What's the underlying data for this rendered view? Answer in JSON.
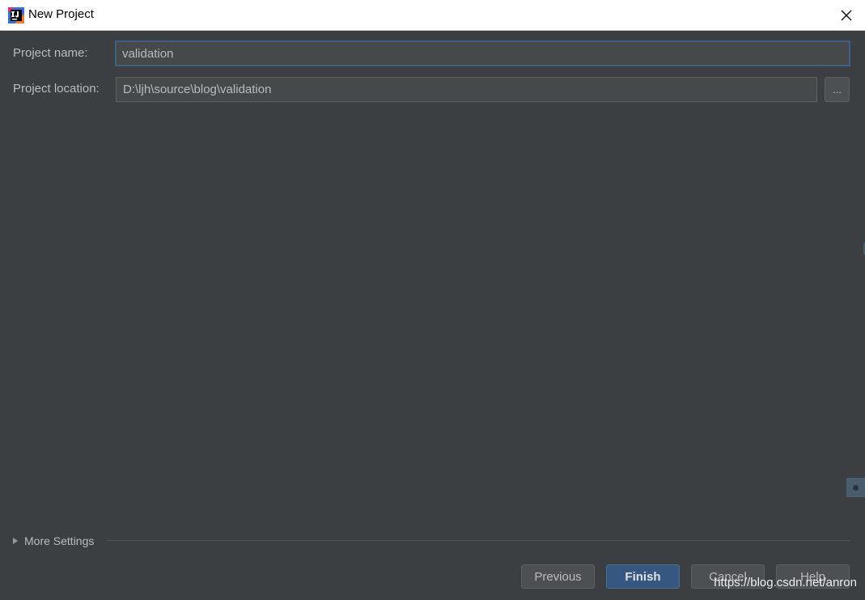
{
  "window": {
    "title": "New Project",
    "app_icon": "intellij-idea-icon"
  },
  "form": {
    "project_name_label": "Project name:",
    "project_name_value": "validation",
    "project_location_label": "Project location:",
    "project_location_value": "D:\\ljh\\source\\blog\\validation",
    "browse_label": "..."
  },
  "more_settings": {
    "label": "More Settings"
  },
  "buttons": {
    "previous": "Previous",
    "finish": "Finish",
    "cancel": "Cancel",
    "help": "Help"
  },
  "watermark": "https://blog.csdn.net/anron",
  "colors": {
    "background": "#3c3f41",
    "field_bg": "#45494a",
    "focus_border": "#3d6185",
    "primary_button": "#365880",
    "text": "#bbbbbb"
  }
}
